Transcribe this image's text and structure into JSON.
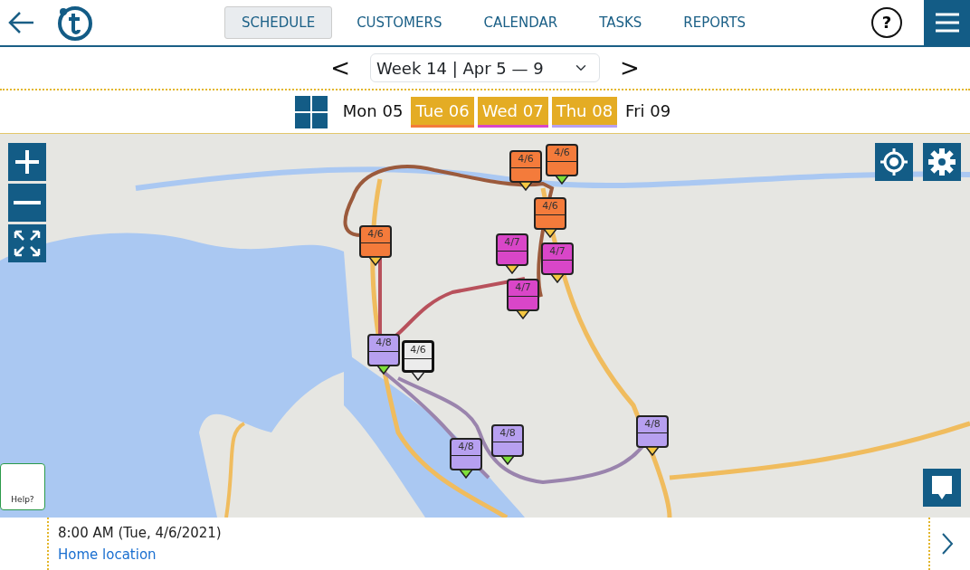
{
  "header": {
    "tabs": [
      {
        "label": "SCHEDULE",
        "selected": true
      },
      {
        "label": "CUSTOMERS",
        "selected": false
      },
      {
        "label": "CALENDAR",
        "selected": false
      },
      {
        "label": "TASKS",
        "selected": false
      },
      {
        "label": "REPORTS",
        "selected": false
      }
    ],
    "help": "?"
  },
  "week": {
    "prev": "<",
    "value": "Week 14 | Apr 5 — 9",
    "next": ">"
  },
  "days": [
    {
      "label": "Mon 05",
      "selected": false
    },
    {
      "label": "Tue 06",
      "selected": true,
      "color": "#f47b3b"
    },
    {
      "label": "Wed 07",
      "selected": true,
      "color": "#d946c8"
    },
    {
      "label": "Thu 08",
      "selected": true,
      "color": "#b7a0f0"
    },
    {
      "label": "Fri 09",
      "selected": false
    }
  ],
  "pins": [
    {
      "label": "4/6",
      "color": "#f47b3b",
      "done": false,
      "selected": false
    },
    {
      "label": "4/6",
      "color": "#f47b3b",
      "done": true,
      "selected": false
    },
    {
      "label": "4/6",
      "color": "#f47b3b",
      "done": false,
      "selected": false
    },
    {
      "label": "4/6",
      "color": "#f47b3b",
      "done": false,
      "selected": false
    },
    {
      "label": "4/7",
      "color": "#d946c8",
      "done": false,
      "selected": false
    },
    {
      "label": "4/7",
      "color": "#d946c8",
      "done": false,
      "selected": false
    },
    {
      "label": "4/7",
      "color": "#d946c8",
      "done": false,
      "selected": false
    },
    {
      "label": "4/8",
      "color": "#b7a0f0",
      "done": true,
      "selected": false
    },
    {
      "label": "4/6",
      "color": "#ececec",
      "done": false,
      "selected": true
    },
    {
      "label": "4/8",
      "color": "#b7a0f0",
      "done": true,
      "selected": false
    },
    {
      "label": "4/8",
      "color": "#b7a0f0",
      "done": true,
      "selected": false
    },
    {
      "label": "4/8",
      "color": "#b7a0f0",
      "done": false,
      "selected": false
    }
  ],
  "help_button": "Help?",
  "footer": {
    "time": "8:00 AM (Tue, 4/6/2021)",
    "location": "Home location"
  }
}
